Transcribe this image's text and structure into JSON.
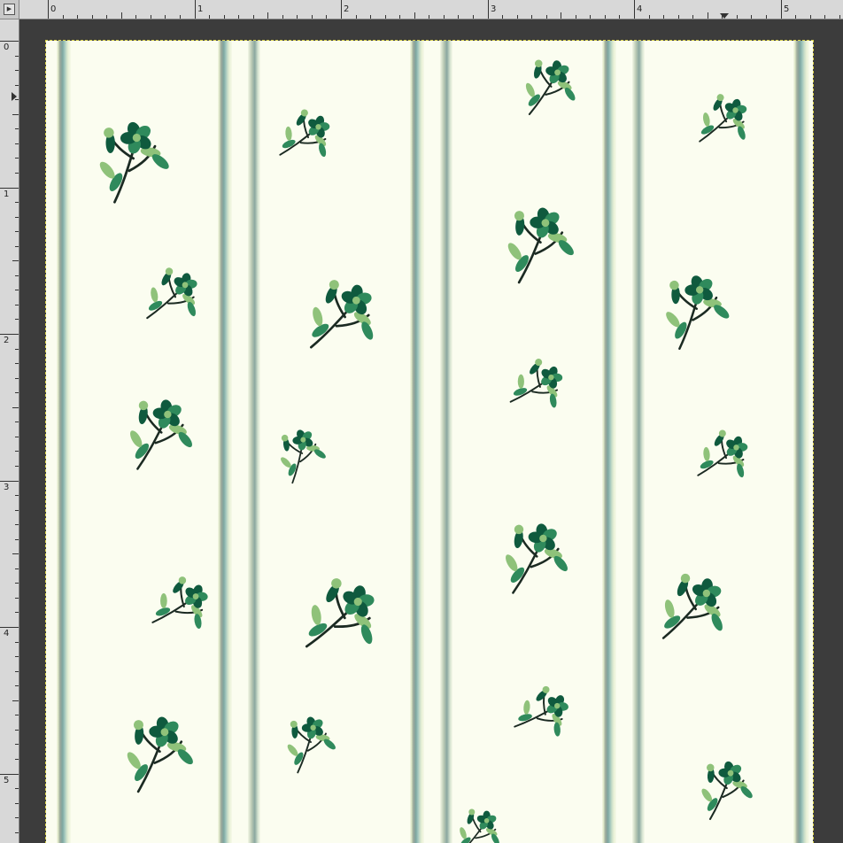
{
  "rulers": {
    "horizontal_labels": [
      "0",
      "1",
      "2",
      "3",
      "4",
      "5"
    ],
    "vertical_labels": [
      "0",
      "1",
      "2",
      "3",
      "4",
      "5"
    ],
    "corner_icon": "menu-arrow-icon"
  },
  "document": {
    "pattern": "floral-stripe",
    "colors": {
      "background": "#fbfdf0",
      "stripe": "#8fa39a",
      "leaf_dark": "#0f5a3e",
      "leaf_mid": "#2f8a5c",
      "leaf_light": "#8fc27a",
      "stem": "#1b2a22",
      "workspace": "#3c3c3c",
      "ruler": "#d8d8d8"
    }
  }
}
